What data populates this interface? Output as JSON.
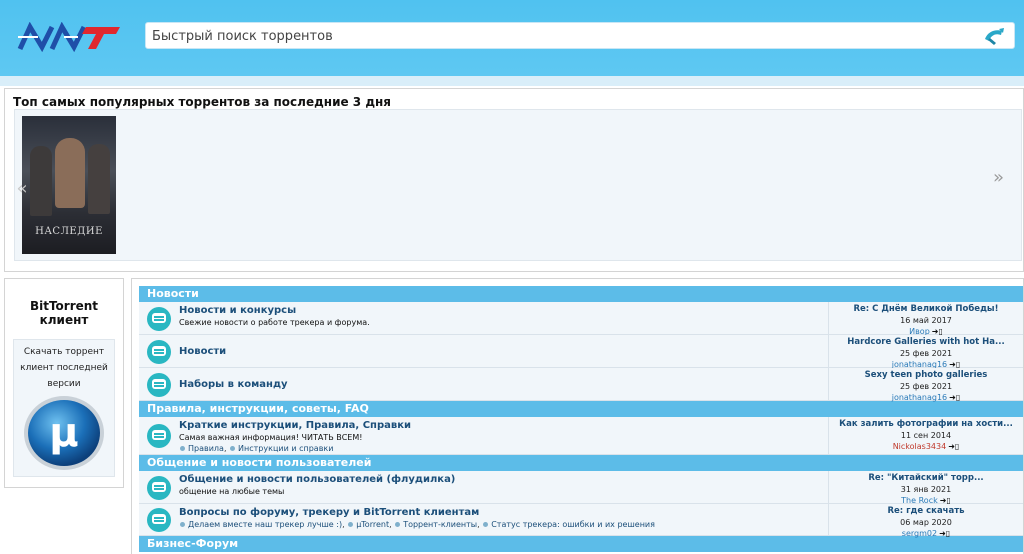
{
  "header": {
    "logo_text": "NNT",
    "search": {
      "placeholder": "Быстрый поиск торрентов"
    }
  },
  "top": {
    "title": "Топ самых популярных торрентов за последние 3 дня",
    "poster_title": "НАСЛЕДИЕ",
    "prev_label": "«",
    "next_label": "»"
  },
  "sidebar": {
    "title": "BitTorrent клиент",
    "text": "Скачать торрент клиент последней версии"
  },
  "forum": {
    "categories": [
      {
        "title": "Новости",
        "forums": [
          {
            "name": "Новости и конкурсы",
            "desc": "Свежие новости о работе трекера и форума.",
            "last_title": "Re: С Днём Великой Победы!",
            "last_date": "16 май 2017",
            "last_user": "Ивор"
          },
          {
            "name": "Новости",
            "desc": "",
            "last_title": "Hardcore Galleries with hot Ha...",
            "last_date": "25 фев 2021",
            "last_user": "jonathanag16"
          },
          {
            "name": "Наборы в команду",
            "desc": "",
            "last_title": "Sexy teen photo galleries",
            "last_date": "25 фев 2021",
            "last_user": "jonathanag16"
          }
        ]
      },
      {
        "title": "Правила, инструкции, советы, FAQ",
        "forums": [
          {
            "name": "Краткие инструкции, Правила, Справки",
            "desc": "Самая важная информация! ЧИТАТЬ ВСЕМ!",
            "subs": [
              "Правила",
              "Инструкции и справки"
            ],
            "last_title": "Как залить фотографии на хости...",
            "last_date": "11 сен 2014",
            "last_user": "Nickolas3434"
          }
        ]
      },
      {
        "title": "Общение и новости пользователей",
        "forums": [
          {
            "name": "Общение и новости пользователей (флудилка)",
            "desc": "общение на любые темы",
            "last_title": "Re: \"Китайский\" торр...",
            "last_date": "31 янв 2021",
            "last_user": "The Rock"
          },
          {
            "name": "Вопросы по форуму, трекеру и BitTorrent клиентам",
            "desc": "",
            "subs": [
              "Делаем вместе наш трекер лучше :)",
              "µTorrent",
              "Торрент-клиенты",
              "Статус трекера: ошибки и их решения"
            ],
            "last_title": "Re: где скачать",
            "last_date": "06 мар 2020",
            "last_user": "sergm02"
          }
        ]
      },
      {
        "title": "Бизнес-Форум",
        "forums": []
      }
    ],
    "goto_glyph": "➜▯"
  }
}
